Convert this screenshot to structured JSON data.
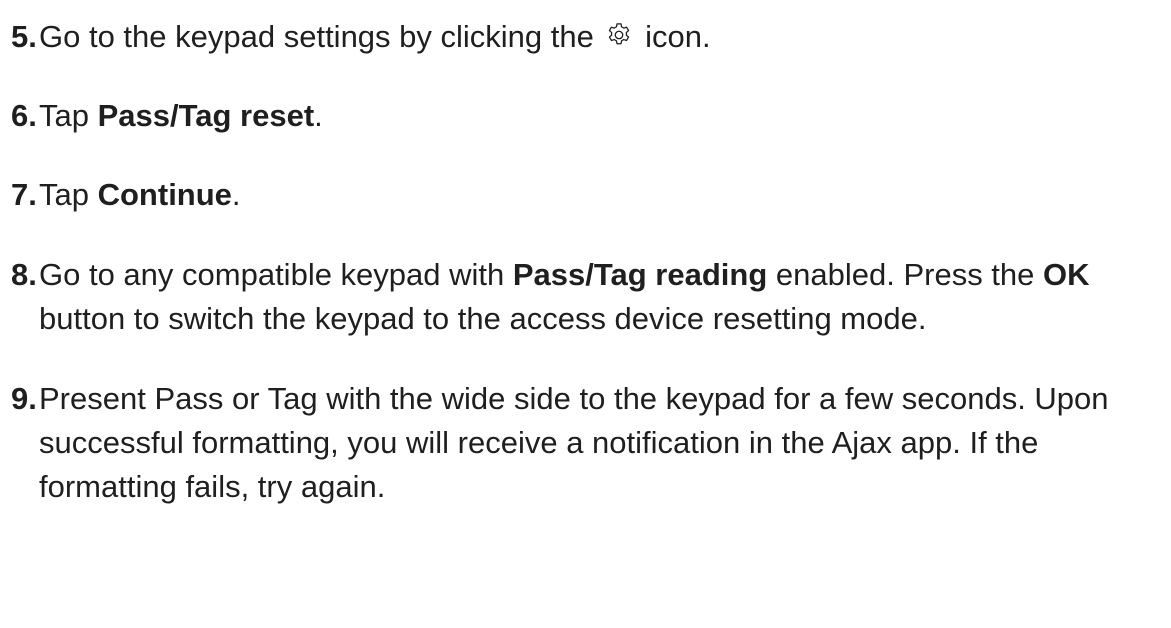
{
  "steps": [
    {
      "number": "5.",
      "parts": [
        "Go to the keypad settings by clicking the",
        "icon."
      ],
      "icon": "gear-icon"
    },
    {
      "number": "6.",
      "parts": [
        "Tap ",
        "Pass/Tag reset",
        "."
      ]
    },
    {
      "number": "7.",
      "parts": [
        "Tap ",
        "Continue",
        "."
      ]
    },
    {
      "number": "8.",
      "parts": [
        "Go to any compatible keypad with ",
        "Pass/Tag reading",
        " enabled. Press the ",
        "OK",
        " button to switch the keypad to the access device resetting mode."
      ]
    },
    {
      "number": "9.",
      "parts": [
        "Present Pass or Tag with the wide side to the keypad for a few seconds. Upon successful formatting, you will receive a notification in the Ajax app. If the formatting fails, try again."
      ]
    }
  ]
}
